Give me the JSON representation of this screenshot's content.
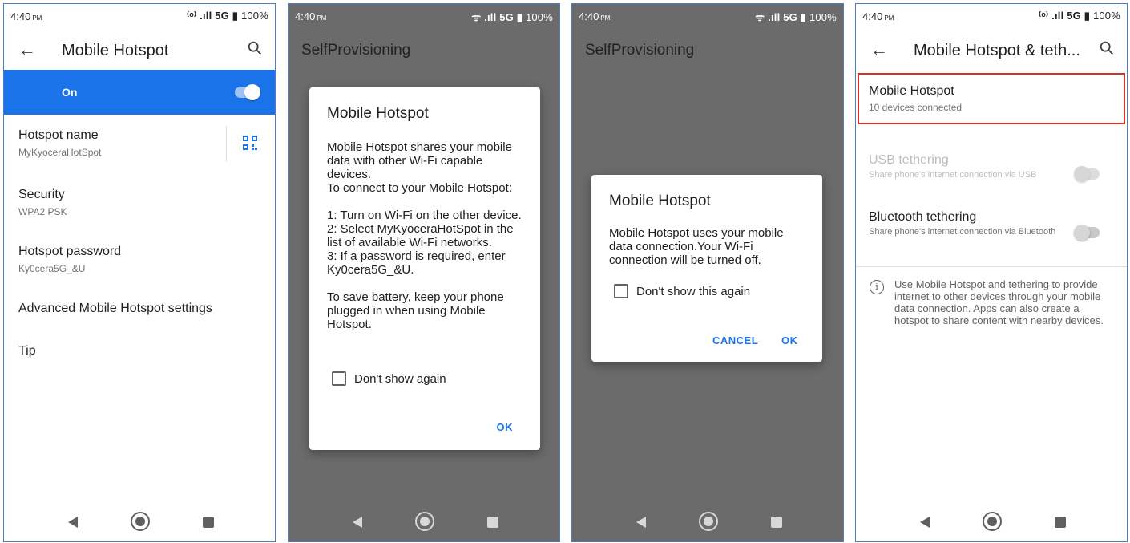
{
  "status": {
    "time": "4:40",
    "ampm": "PM",
    "network": "5G",
    "battery": "100%"
  },
  "screen1": {
    "title": "Mobile Hotspot",
    "toggle_label": "On",
    "items": [
      {
        "title": "Hotspot name",
        "subtitle": "MyKyoceraHotSpot"
      },
      {
        "title": "Security",
        "subtitle": "WPA2 PSK"
      },
      {
        "title": "Hotspot password",
        "subtitle": "Ky0cera5G_&U"
      },
      {
        "title": "Advanced Mobile Hotspot settings"
      },
      {
        "title": "Tip"
      }
    ]
  },
  "screen2": {
    "app_title": "SelfProvisioning",
    "dialog_title": "Mobile Hotspot",
    "dialog_body": "Mobile Hotspot shares your mobile data with other Wi-Fi capable devices.\nTo connect to your Mobile Hotspot:\n\n1: Turn on Wi-Fi on the other device.\n2: Select MyKyoceraHotSpot in the list of available Wi-Fi networks.\n3: If a password is required, enter Ky0cera5G_&U.\n\nTo save battery, keep your phone plugged in when using Mobile Hotspot.",
    "checkbox_label": "Don't show again",
    "ok_label": "OK"
  },
  "screen3": {
    "app_title": "SelfProvisioning",
    "dialog_title": "Mobile Hotspot",
    "dialog_body": "Mobile Hotspot uses your mobile data connection.Your Wi-Fi connection will be turned off.",
    "checkbox_label": "Don't show this again",
    "cancel_label": "CANCEL",
    "ok_label": "OK"
  },
  "screen4": {
    "title": "Mobile Hotspot & teth...",
    "hotspot": {
      "title": "Mobile Hotspot",
      "subtitle": "10 devices connected"
    },
    "usb": {
      "title": "USB tethering",
      "subtitle": "Share phone's internet connection via USB"
    },
    "bluetooth": {
      "title": "Bluetooth tethering",
      "subtitle": "Share phone's internet connection via Bluetooth"
    },
    "info": "Use Mobile Hotspot and tethering to provide internet to other devices through your mobile data connection. Apps can also create a hotspot to share content with nearby devices."
  },
  "colors": {
    "accent": "#1a73e8",
    "highlight": "#d93025",
    "scrim": "#6b6b6b"
  },
  "icons": [
    "back-arrow-icon",
    "search-icon",
    "qr-code-icon",
    "info-icon",
    "hotspot-status-icon",
    "signal-icon",
    "battery-icon",
    "wifi-icon"
  ]
}
